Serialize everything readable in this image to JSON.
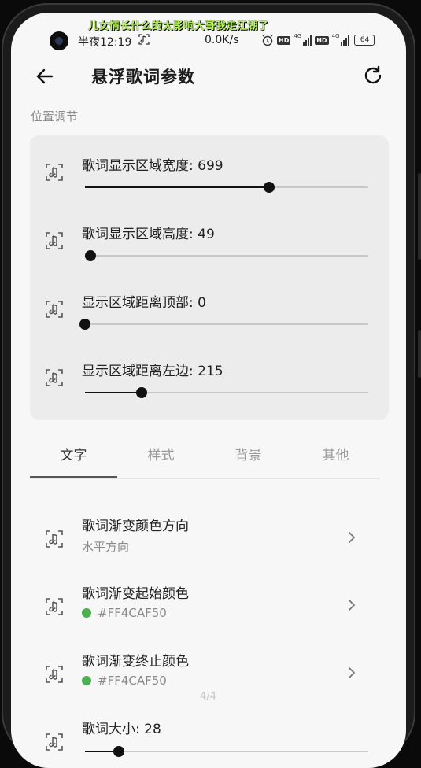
{
  "notification": "儿女情长什么的太影响大哥我走江湖了",
  "status": {
    "time": "半夜12:19",
    "speed": "0.0K/s",
    "hd1": "HD",
    "hd2": "HD",
    "net1": "4G",
    "net2": "4G",
    "battery": "64"
  },
  "header": {
    "title": "悬浮歌词参数"
  },
  "section": "位置调节",
  "sliders": [
    {
      "label": "歌词显示区域宽度: 699",
      "fraction": 0.65
    },
    {
      "label": "歌词显示区域高度: 49",
      "fraction": 0.02
    },
    {
      "label": "显示区域距离顶部: 0",
      "fraction": 0.0
    },
    {
      "label": "显示区域距离左边: 215",
      "fraction": 0.2
    }
  ],
  "tabs": [
    {
      "label": "文字"
    },
    {
      "label": "样式"
    },
    {
      "label": "背景"
    },
    {
      "label": "其他"
    }
  ],
  "active_tab": 0,
  "items": [
    {
      "title": "歌词渐变颜色方向",
      "subtitle": "水平方向",
      "color": ""
    },
    {
      "title": "歌词渐变起始颜色",
      "subtitle": "#FF4CAF50",
      "color": "#4CAF50"
    },
    {
      "title": "歌词渐变终止颜色",
      "subtitle": "#FF4CAF50",
      "color": "#4CAF50"
    }
  ],
  "pager": "4/4",
  "size_slider": {
    "label": "歌词大小: 28",
    "fraction": 0.12
  },
  "icons": {
    "back": "arrow-left-icon",
    "reset": "refresh-icon",
    "lyric": "lyric-frame-icon",
    "chevron": "chevron-right-icon"
  }
}
